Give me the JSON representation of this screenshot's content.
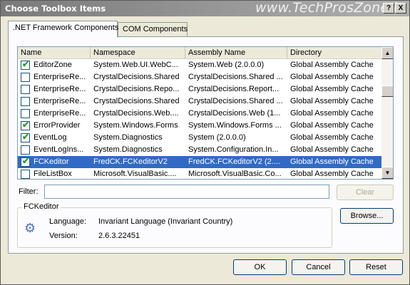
{
  "window": {
    "title": "Choose Toolbox Items",
    "watermark": "www.TechProsZone.i",
    "controls": [
      "?",
      "X"
    ]
  },
  "tabs": [
    {
      "label": ".NET Framework Components",
      "active": true
    },
    {
      "label": "COM Components",
      "active": false
    }
  ],
  "list": {
    "columns": [
      "Name",
      "Namespace",
      "Assembly Name",
      "Directory"
    ],
    "rows": [
      {
        "checked": true,
        "name": "EditorZone",
        "namespace": "System.Web.UI.WebC...",
        "assembly": "System.Web (2.0.0.0)",
        "directory": "Global Assembly Cache",
        "selected": false
      },
      {
        "checked": false,
        "name": "EnterpriseRe...",
        "namespace": "CrystalDecisions.Shared",
        "assembly": "CrystalDecisions.Shared ...",
        "directory": "Global Assembly Cache",
        "selected": false
      },
      {
        "checked": false,
        "name": "EnterpriseRe...",
        "namespace": "CrystalDecisions.Repo...",
        "assembly": "CrystalDecisions.Report...",
        "directory": "Global Assembly Cache",
        "selected": false
      },
      {
        "checked": false,
        "name": "EnterpriseRe...",
        "namespace": "CrystalDecisions.Shared",
        "assembly": "CrystalDecisions.Shared ...",
        "directory": "Global Assembly Cache",
        "selected": false
      },
      {
        "checked": false,
        "name": "EnterpriseRe...",
        "namespace": "CrystalDecisions.Web....",
        "assembly": "CrystalDecisions.Web (1...",
        "directory": "Global Assembly Cache",
        "selected": false
      },
      {
        "checked": true,
        "name": "ErrorProvider",
        "namespace": "System.Windows.Forms",
        "assembly": "System.Windows.Forms ...",
        "directory": "Global Assembly Cache",
        "selected": false
      },
      {
        "checked": true,
        "name": "EventLog",
        "namespace": "System.Diagnostics",
        "assembly": "System (2.0.0.0)",
        "directory": "Global Assembly Cache",
        "selected": false
      },
      {
        "checked": false,
        "name": "EventLogIns...",
        "namespace": "System.Diagnostics",
        "assembly": "System.Configuration.In...",
        "directory": "Global Assembly Cache",
        "selected": false
      },
      {
        "checked": true,
        "name": "FCKeditor",
        "namespace": "FredCK.FCKeditorV2",
        "assembly": "FredCK.FCKeditorV2 (2....",
        "directory": "Global Assembly Cache",
        "selected": true
      },
      {
        "checked": false,
        "name": "FileListBox",
        "namespace": "Microsoft.VisualBasic....",
        "assembly": "Microsoft.VisualBasic.Co...",
        "directory": "Global Assembly Cache",
        "selected": false
      }
    ]
  },
  "filter": {
    "label": "Filter:",
    "value": "",
    "clear_label": "Clear"
  },
  "details": {
    "group_title": "FCKeditor",
    "language_label": "Language:",
    "language_value": "Invariant Language (Invariant Country)",
    "version_label": "Version:",
    "version_value": "2.6.3.22451",
    "browse_label": "Browse..."
  },
  "footer": {
    "ok_label": "OK",
    "cancel_label": "Cancel",
    "reset_label": "Reset"
  }
}
